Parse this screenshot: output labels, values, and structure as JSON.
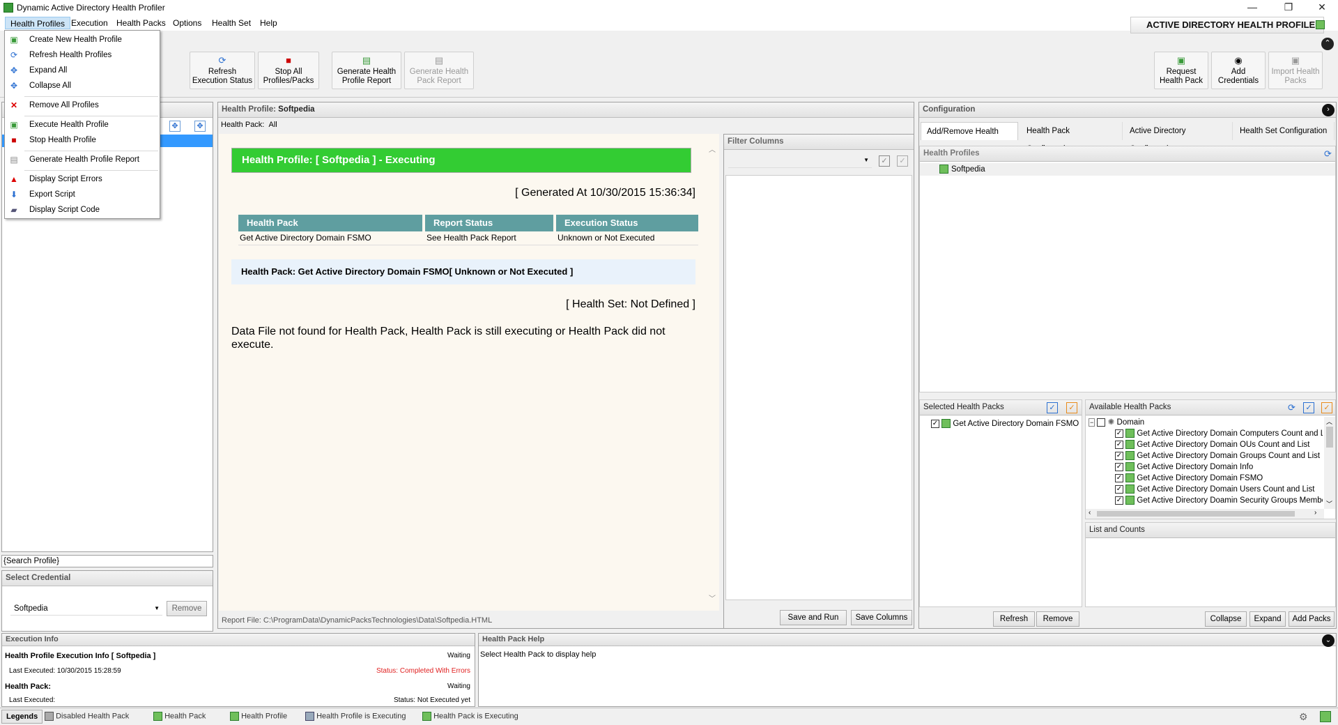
{
  "window": {
    "title": "Dynamic Active Directory Health Profiler",
    "min": "—",
    "restore": "❐",
    "close": "✕"
  },
  "menu": [
    "Health Profiles",
    "Execution",
    "Health Packs",
    "Options",
    "Health Set",
    "Help"
  ],
  "brand": "ACTIVE DIRECTORY HEALTH PROFILER",
  "dropdown": [
    {
      "label": "Create New Health Profile",
      "icon": "new-profile-icon"
    },
    {
      "label": "Refresh Health Profiles",
      "icon": "refresh-icon"
    },
    {
      "label": "Expand All",
      "icon": "expand-icon"
    },
    {
      "label": "Collapse All",
      "icon": "collapse-icon"
    },
    {
      "label": "Remove All Profiles",
      "icon": "remove-icon"
    },
    {
      "label": "Execute Health Profile",
      "icon": "execute-icon"
    },
    {
      "label": "Stop Health Profile",
      "icon": "stop-icon"
    },
    {
      "label": "Generate Health Profile Report",
      "icon": "report-icon"
    },
    {
      "label": "Display Script Errors",
      "icon": "warning-icon"
    },
    {
      "label": "Export Script",
      "icon": "export-icon"
    },
    {
      "label": "Display Script Code",
      "icon": "code-icon"
    }
  ],
  "toolbar": {
    "refresh": "Refresh\nExecution Status",
    "stop_all": "Stop All\nProfiles/Packs",
    "gen_report": "Generate Health\nProfile Report",
    "gen_pack_report": "Generate Health\nPack Report",
    "request": "Request\nHealth Pack",
    "add_cred": "Add\nCredentials",
    "import": "Import Health\nPacks"
  },
  "left": {
    "search_placeholder": "{Search Profile}",
    "credential_header": "Select Credential",
    "credential_value": "Softpedia",
    "remove": "Remove"
  },
  "center": {
    "profile_label": "Health Profile:",
    "profile_value": "Softpedia",
    "pack_label": "Health Pack:",
    "pack_value": "All",
    "banner": "Health Profile: [ Softpedia ] - Executing",
    "generated": "[ Generated At 10/30/2015 15:36:34]",
    "table_headers": [
      "Health Pack",
      "Report Status",
      "Execution Status"
    ],
    "table_row": [
      "Get Active Directory Domain FSMO",
      "See Health Pack Report",
      "Unknown or Not Executed"
    ],
    "pack_box": "Health Pack: Get Active Directory Domain FSMO[ Unknown or Not Executed ]",
    "health_set": "[ Health Set: Not Defined ]",
    "message": "Data File not found for Health Pack, Health Pack is still executing or Health Pack did not execute.",
    "report_file": "Report File: C:\\ProgramData\\DynamicPacksTechnologies\\Data\\Softpedia.HTML"
  },
  "filter": {
    "header": "Filter Columns",
    "save_run": "Save and Run",
    "save_cols": "Save Columns"
  },
  "config": {
    "header": "Configuration",
    "tabs": [
      "Add/Remove Health Packs",
      "Health Pack Configuration",
      "Active Directory Configuration",
      "Health Set Configuration"
    ],
    "profiles_header": "Health Profiles",
    "profiles": [
      "Softpedia"
    ],
    "selected_header": "Selected Health Packs",
    "selected": [
      "Get Active Directory Domain FSMO"
    ],
    "available_header": "Available Health Packs",
    "available_root": "Domain",
    "available": [
      "Get Active Directory Domain Computers Count and List",
      "Get Active Directory Domain OUs Count and List",
      "Get Active Directory Domain Groups Count and List",
      "Get Active Directory Domain Info",
      "Get Active Directory Domain FSMO",
      "Get Active Directory Domain Users Count and List",
      "Get Active Directory Doamin Security Groups Membership"
    ],
    "list_counts": "List and Counts",
    "refresh": "Refresh",
    "remove": "Remove",
    "collapse": "Collapse",
    "expand": "Expand",
    "add_packs": "Add Packs"
  },
  "exec": {
    "header": "Execution Info",
    "profile_info": "Health Profile Execution Info [ Softpedia ]",
    "waiting1": "Waiting",
    "last_exec": "Last Executed: 10/30/2015 15:28:59",
    "status1": "Status: Completed With Errors",
    "pack": "Health Pack:",
    "waiting2": "Waiting",
    "last_exec2": "Last Executed:",
    "status2": "Status: Not Executed yet"
  },
  "help": {
    "header": "Health Pack Help",
    "text": "Select Health Pack to display help"
  },
  "legends": {
    "label": "Legends",
    "items": [
      "Disabled Health Pack",
      "Health Pack",
      "Health Profile",
      "Health Profile is Executing",
      "Health Pack is Executing"
    ]
  },
  "colors": {
    "banner": "#33cc33",
    "table_header": "#5f9ea0",
    "error": "#e02020"
  }
}
